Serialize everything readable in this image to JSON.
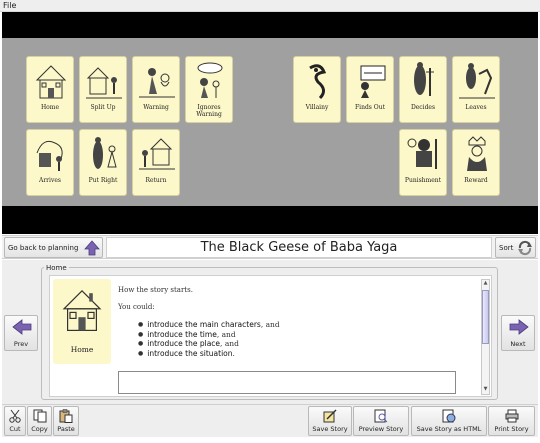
{
  "menu": {
    "file": "File"
  },
  "cards": {
    "home": "Home",
    "split_up": "Split Up",
    "warning": "Warning",
    "ignores_warning": "Ignores Warning",
    "arrives": "Arrives",
    "put_right": "Put Right",
    "return": "Return",
    "villainy": "Villainy",
    "finds_out": "Finds Out",
    "decides": "Decides",
    "leaves": "Leaves",
    "punishment": "Punishment",
    "reward": "Reward"
  },
  "navbar": {
    "go_back": "Go back to planning",
    "title": "The Black Geese of Baba Yaga",
    "sort": "Sort"
  },
  "detail": {
    "frame_title": "Home",
    "prev": "Prev",
    "next": "Next",
    "card_label": "Home",
    "intro": "How the story starts.",
    "could": "You could:",
    "bullets": [
      {
        "strong": "introduce the main characters",
        "tail": ", and"
      },
      {
        "strong": "introduce the time",
        "tail": ", and"
      },
      {
        "strong": "introduce the place",
        "tail": ", and"
      },
      {
        "strong": "introduce the situation",
        "tail": "."
      }
    ]
  },
  "toolbar": {
    "cut": "Cut",
    "copy": "Copy",
    "paste": "Paste",
    "save_story": "Save Story",
    "preview_story": "Preview Story",
    "save_html": "Save Story as HTML",
    "print_story": "Print Story"
  },
  "colors": {
    "card_bg": "#fcf8c9",
    "board_bg": "#a0a0a0",
    "arrow_purple": "#7a63b0"
  }
}
